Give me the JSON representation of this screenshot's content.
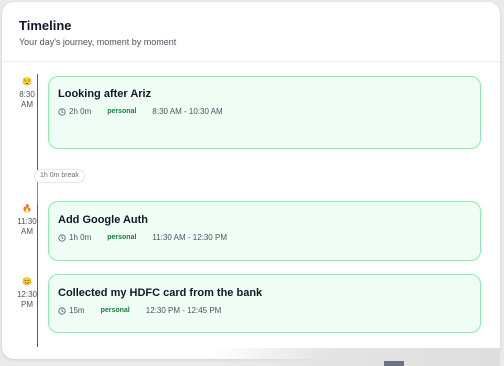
{
  "header": {
    "title": "Timeline",
    "subtitle": "Your day's journey, moment by moment"
  },
  "break": {
    "label": "1h 0m break"
  },
  "events": [
    {
      "emoji": "😌",
      "time": "8:30\nAM",
      "title": "Looking after Ariz",
      "duration": "2h 0m",
      "tag": "personal",
      "range": "8:30 AM - 10:30 AM"
    },
    {
      "emoji": "🔥",
      "time": "11:30\nAM",
      "title": "Add Google Auth",
      "duration": "1h 0m",
      "tag": "personal",
      "range": "11:30 AM - 12:30 PM"
    },
    {
      "emoji": "😊",
      "time": "12:30\nPM",
      "title": "Collected my HDFC card from the bank",
      "duration": "15m",
      "tag": "personal",
      "range": "12:30 PM - 12:45 PM"
    }
  ],
  "colors": {
    "event_bg": "#f0fdf4",
    "event_border": "#86efac",
    "tag": "#15803d",
    "line_busy": "#dc2626",
    "line_free": "#22c55e"
  },
  "icons": {
    "duration": "clock-icon"
  }
}
